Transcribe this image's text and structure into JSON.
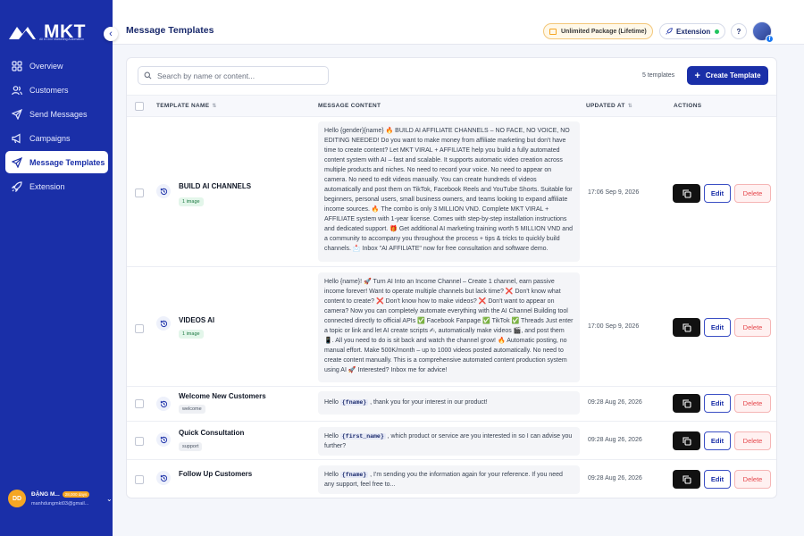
{
  "brand": {
    "name": "MKT",
    "tagline": "All in One Marketing Automation"
  },
  "sidebar": {
    "items": [
      {
        "label": "Overview",
        "icon": "grid-icon"
      },
      {
        "label": "Customers",
        "icon": "users-icon"
      },
      {
        "label": "Send Messages",
        "icon": "send-icon"
      },
      {
        "label": "Campaigns",
        "icon": "megaphone-icon"
      },
      {
        "label": "Message Templates",
        "icon": "send-icon",
        "active": true
      },
      {
        "label": "Extension",
        "icon": "rocket-icon"
      }
    ],
    "user": {
      "initials": "DD",
      "name": "ĐẶNG M...",
      "days": "28,000 days",
      "email": "manhdungmkt03@gmail..."
    }
  },
  "header": {
    "title": "Message Templates",
    "package": "Unlimited Package (Lifetime)",
    "extension": "Extension",
    "help": "?"
  },
  "toolbar": {
    "search_placeholder": "Search by name or content...",
    "count": "5 templates",
    "create_label": "Create Template"
  },
  "table": {
    "columns": {
      "name": "TEMPLATE NAME",
      "content": "MESSAGE CONTENT",
      "updated": "UPDATED AT",
      "actions": "ACTIONS"
    },
    "actions": {
      "edit": "Edit",
      "delete": "Delete"
    },
    "rows": [
      {
        "name": "BUILD AI CHANNELS",
        "tag": "1 image",
        "content": "Hello {gender}{name} 🔥 BUILD AI AFFILIATE CHANNELS – NO FACE, NO VOICE, NO EDITING NEEDED! Do you want to make money from affiliate marketing but don't have time to create content? Let MKT VIRAL + AFFILIATE help you build a fully automated content system with AI – fast and scalable. It supports automatic video creation across multiple products and niches. No need to record your voice. No need to appear on camera. No need to edit videos manually. You can create hundreds of videos automatically and post them on TikTok, Facebook Reels and YouTube Shorts. Suitable for beginners, personal users, small business owners, and teams looking to expand affiliate income sources. 🔥 The combo is only 3 MILLION VND. Complete MKT VIRAL + AFFILIATE system with 1-year license. Comes with step-by-step installation instructions and dedicated support. 🎁 Get additional AI marketing training worth 5 MILLION VND and a community to accompany you throughout the process + tips & tricks to quickly build channels. 📩 Inbox \"AI AFFILIATE\" now for free consultation and software demo.",
        "updated": "17:06 Sep 9, 2026"
      },
      {
        "name": "VIDEOS AI",
        "tag": "1 image",
        "content": "Hello {name}! 🚀 Turn AI Into an Income Channel – Create 1 channel, earn passive income forever! Want to operate multiple channels but lack time? ❌ Don't know what content to create? ❌ Don't know how to make videos? ❌ Don't want to appear on camera? Now you can completely automate everything with the AI Channel Building tool connected directly to official APIs ✅ Facebook Fanpage ✅ TikTok ✅ Threads Just enter a topic or link and let AI create scripts ✍, automatically make videos 🎬, and post them 📱. All you need to do is sit back and watch the channel grow! 🔥 Automatic posting, no manual effort. Make 500K/month – up to 1000 videos posted automatically. No need to create content manually. This is a comprehensive automated content production system using AI 🚀 Interested? Inbox me for advice!",
        "updated": "17:00 Sep 9, 2026"
      },
      {
        "name": "Welcome New Customers",
        "tag": "welcome",
        "content_pre": "Hello",
        "content_var": "{fname}",
        "content_post": ", thank you for your interest in our product!",
        "updated": "09:28 Aug 26, 2026"
      },
      {
        "name": "Quick Consultation",
        "tag": "support",
        "content_pre": "Hello",
        "content_var": "{first_name}",
        "content_post": ", which product or service are you interested in so I can advise you further?",
        "updated": "09:28 Aug 26, 2026"
      },
      {
        "name": "Follow Up Customers",
        "tag": "",
        "content_pre": "Hello",
        "content_var": "{fname}",
        "content_post": ", I'm sending you the information again for your reference. If you need any support, feel free to...",
        "updated": "09:28 Aug 26, 2026"
      }
    ]
  },
  "colors": {
    "primary": "#1a2fa8",
    "danger": "#e5484d",
    "success": "#22c55e"
  }
}
